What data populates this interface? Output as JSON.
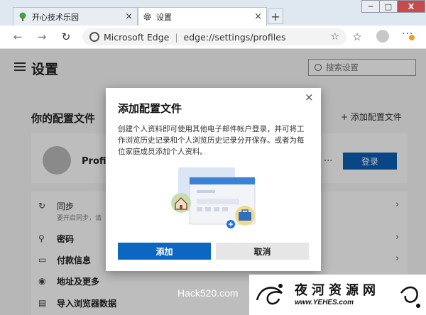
{
  "tabs": [
    {
      "label": "开心技术乐园",
      "close": "×"
    },
    {
      "label": "设置",
      "close": "×"
    }
  ],
  "new_tab": "+",
  "window_controls": {
    "minimize": "─",
    "maximize": "□",
    "close": "X"
  },
  "address_bar": {
    "site": "Microsoft Edge",
    "separator": "|",
    "url": "edge://settings/profiles"
  },
  "settings": {
    "title": "设置",
    "search_placeholder": "搜索设置",
    "section_title": "你的配置文件",
    "add_profile": "+ 添加配置文件",
    "profile_name": "Profil",
    "profile_more": "···",
    "login": "登录",
    "rows": [
      {
        "label": "同步",
        "sub": "要开启同步，请"
      },
      {
        "label": "密码"
      },
      {
        "label": "付款信息"
      },
      {
        "label": "地址及更多"
      },
      {
        "label": "导入浏览器数据"
      }
    ]
  },
  "dialog": {
    "title": "添加配置文件",
    "description": "创建个人资料即可使用其他电子邮件帐户登录，并可将工作浏览历史记录和个人浏览历史记录分开保存。或者为每位家庭成员添加个人资料。",
    "add": "添加",
    "cancel": "取消",
    "close": "×"
  },
  "watermarks": {
    "left": "Hack520.com",
    "right_title": "夜河资源网",
    "right_url": "www.YEHES.com"
  },
  "colors": {
    "primary_button": "#0c67c3",
    "login_button": "#0c5fb5",
    "close_button": "#c74b4b"
  }
}
